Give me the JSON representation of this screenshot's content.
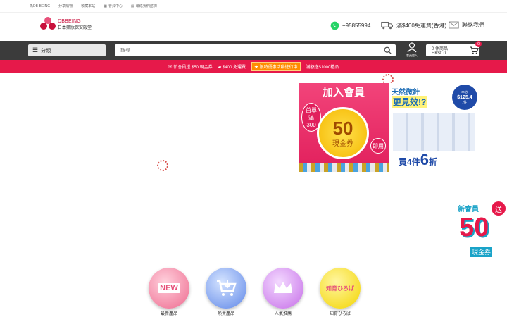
{
  "topbar": {
    "items": [
      "為DB-BEING",
      "分享購物",
      "收藏本站",
      "會員中心",
      "聯絡我們諮詢"
    ]
  },
  "header": {
    "logo_text": "DBBEING",
    "logo_sub": "日本藥妝保安殿堂",
    "phone": "+95855994",
    "shipping": "滿$400免運費(香港)",
    "contact": "聯絡我們"
  },
  "nav": {
    "category_label": "分類",
    "search_placeholder": "搜尋...",
    "account_label": "會員登入",
    "cart_label": "0 件商品 - HK$0.0",
    "cart_count": "0"
  },
  "promo": {
    "item1": "新會員送 $50 現金券",
    "item2": "$400 免運費",
    "item3": "限時優惠活動進行中",
    "item4": "滿額送$1000禮品"
  },
  "banner_left": {
    "title": "加入會員",
    "first": "首單滿300",
    "amount": "50",
    "coupon": "現金券",
    "tag": "即用"
  },
  "banner_right": {
    "line1": "天然微針",
    "line2": "更見效!?",
    "price_label": "平均",
    "price": "$125.4",
    "price_unit": "/件",
    "deal_text": "買4件",
    "deal_num": "6",
    "deal_suffix": "折"
  },
  "side_promo": {
    "line1": "新會員",
    "send": "送",
    "amount": "50",
    "coupon": "現金券"
  },
  "circles": [
    {
      "label": "最新產品",
      "icon_text": "NEW"
    },
    {
      "label": "熱賣產品",
      "icon_text": ""
    },
    {
      "label": "人氣推薦",
      "icon_text": ""
    },
    {
      "label": "知育ひろば",
      "icon_text": "知育ひろば"
    }
  ],
  "colors": {
    "accent": "#e6194a",
    "nav_bg": "#3b3b3b",
    "brand": "#c8103c"
  }
}
